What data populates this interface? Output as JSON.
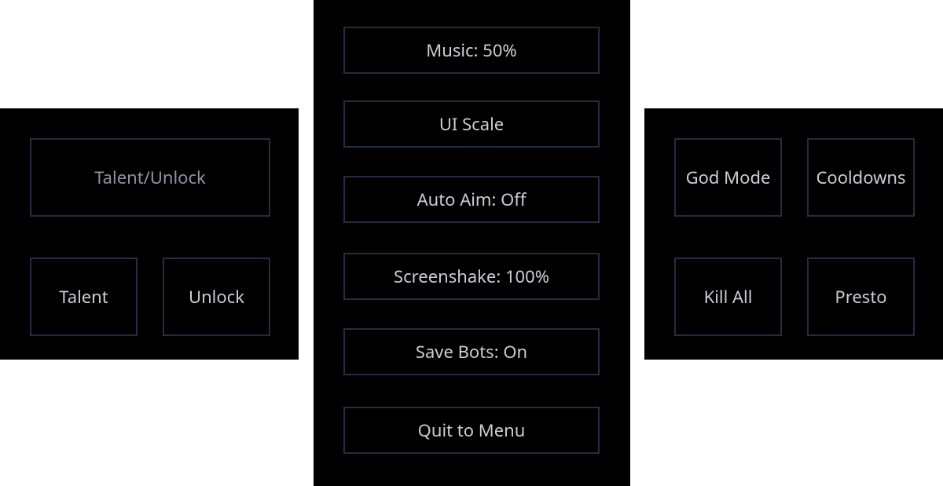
{
  "left": {
    "talent_unlock": "Talent/Unlock",
    "talent": "Talent",
    "unlock": "Unlock"
  },
  "center": {
    "music": "Music: 50%",
    "ui_scale": "UI Scale",
    "auto_aim": "Auto Aim: Off",
    "screenshake": "Screenshake: 100%",
    "save_bots": "Save Bots: On",
    "quit": "Quit to Menu"
  },
  "right": {
    "god_mode": "God Mode",
    "cooldowns": "Cooldowns",
    "kill_all": "Kill All",
    "presto": "Presto"
  }
}
